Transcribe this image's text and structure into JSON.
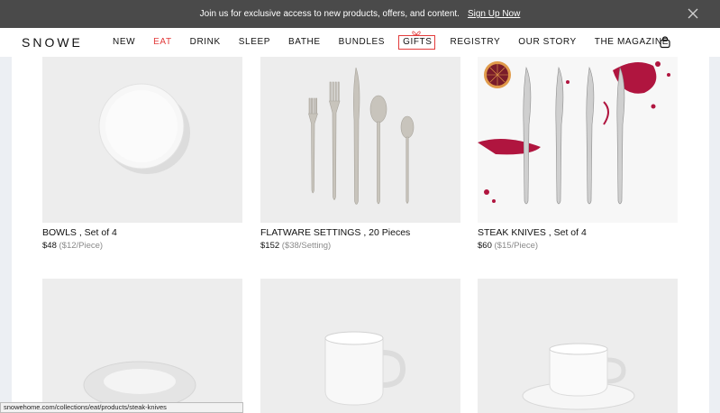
{
  "announcement": {
    "message": "Join us for exclusive access to new products, offers, and content.",
    "cta": "Sign Up Now",
    "close_icon": "close-icon"
  },
  "header": {
    "logo": "SNOWE",
    "nav": [
      {
        "label": "NEW"
      },
      {
        "label": "EAT",
        "active": true
      },
      {
        "label": "DRINK"
      },
      {
        "label": "SLEEP"
      },
      {
        "label": "BATHE"
      },
      {
        "label": "BUNDLES"
      },
      {
        "label": "GIFTS"
      },
      {
        "label": "REGISTRY"
      },
      {
        "label": "OUR STORY"
      },
      {
        "label": "THE MAGAZINE"
      }
    ],
    "cart_icon": "bag-icon"
  },
  "products": [
    {
      "name": "BOWLS , Set of 4",
      "price": "$48",
      "unit_price": "($12/Piece)"
    },
    {
      "name": "FLATWARE SETTINGS , 20 Pieces",
      "price": "$152",
      "unit_price": "($38/Setting)"
    },
    {
      "name": "STEAK KNIVES , Set of 4",
      "price": "$60",
      "unit_price": "($15/Piece)"
    },
    {
      "name": "",
      "price": "",
      "unit_price": ""
    },
    {
      "name": "",
      "price": "",
      "unit_price": ""
    },
    {
      "name": "",
      "price": "",
      "unit_price": ""
    }
  ],
  "status_bar": {
    "url": "snowehome.com/collections/eat/products/steak-knives"
  },
  "colors": {
    "announcement_bg": "#4a4a4a",
    "accent": "#e23b3b",
    "muted_price": "#8a8a8a"
  }
}
